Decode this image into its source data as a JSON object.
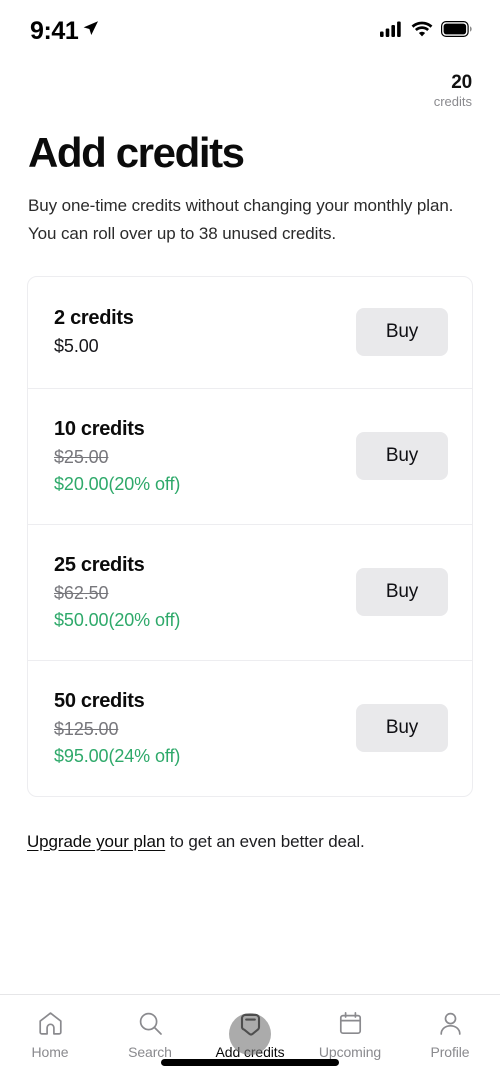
{
  "status_bar": {
    "time": "9:41",
    "location_icon": "location-arrow-icon",
    "signal_icon": "cellular-signal-icon",
    "wifi_icon": "wifi-icon",
    "battery_icon": "battery-full-icon"
  },
  "credits_badge": {
    "count": "20",
    "label": "credits"
  },
  "header": {
    "title": "Add credits",
    "subtitle": "Buy one-time credits without changing your monthly plan. You can roll over up to 38 unused credits."
  },
  "packages": [
    {
      "credits": "2 credits",
      "original_price": "",
      "price": "$5.00",
      "discounted": false,
      "buy_label": "Buy"
    },
    {
      "credits": "10 credits",
      "original_price": "$25.00",
      "price": "$20.00(20% off)",
      "discounted": true,
      "buy_label": "Buy"
    },
    {
      "credits": "25 credits",
      "original_price": "$62.50",
      "price": "$50.00(20% off)",
      "discounted": true,
      "buy_label": "Buy"
    },
    {
      "credits": "50 credits",
      "original_price": "$125.00",
      "price": "$95.00(24% off)",
      "discounted": true,
      "buy_label": "Buy"
    }
  ],
  "upgrade_note": {
    "link_text": "Upgrade your plan",
    "rest_text": " to get an even better deal."
  },
  "tab_bar": {
    "items": [
      {
        "label": "Home",
        "icon": "home-icon",
        "active": false
      },
      {
        "label": "Search",
        "icon": "search-icon",
        "active": false
      },
      {
        "label": "Add credits",
        "icon": "add-credits-icon",
        "active": true
      },
      {
        "label": "Upcoming",
        "icon": "calendar-icon",
        "active": false
      },
      {
        "label": "Profile",
        "icon": "person-icon",
        "active": false
      }
    ]
  },
  "colors": {
    "accent_green": "#2ea96a",
    "button_gray": "#e9e9eb",
    "inactive_gray": "#8a8a8e",
    "text_dark": "#0b0b0b",
    "border": "#ededf0"
  }
}
